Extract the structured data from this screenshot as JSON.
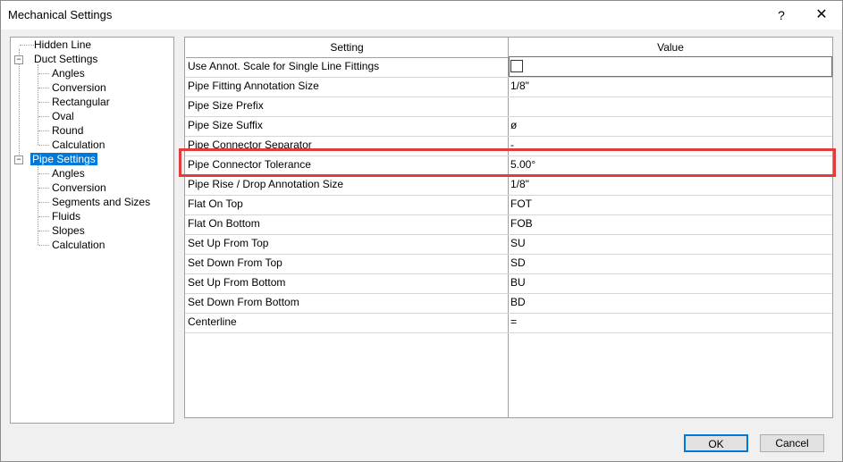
{
  "window": {
    "title": "Mechanical Settings",
    "help": "?",
    "close": "✕"
  },
  "tree": {
    "hidden_line": "Hidden Line",
    "duct_settings": "Duct Settings",
    "duct_children": [
      "Angles",
      "Conversion",
      "Rectangular",
      "Oval",
      "Round",
      "Calculation"
    ],
    "pipe_settings": "Pipe Settings",
    "pipe_children": [
      "Angles",
      "Conversion",
      "Segments and Sizes",
      "Fluids",
      "Slopes",
      "Calculation"
    ],
    "selected": "Pipe Settings",
    "collapse_glyph": "−"
  },
  "grid": {
    "headers": {
      "setting": "Setting",
      "value": "Value"
    },
    "rows": [
      {
        "setting": "Use Annot. Scale for Single Line Fittings",
        "value": ""
      },
      {
        "setting": "Pipe Fitting Annotation Size",
        "value": "1/8\""
      },
      {
        "setting": "Pipe Size Prefix",
        "value": ""
      },
      {
        "setting": "Pipe Size Suffix",
        "value": "ø"
      },
      {
        "setting": "Pipe Connector Separator",
        "value": "-"
      },
      {
        "setting": "Pipe Connector Tolerance",
        "value": "5.00°"
      },
      {
        "setting": "Pipe Rise / Drop Annotation Size",
        "value": "1/8\""
      },
      {
        "setting": "Flat On Top",
        "value": "FOT"
      },
      {
        "setting": "Flat On Bottom",
        "value": "FOB"
      },
      {
        "setting": "Set Up From Top",
        "value": "SU"
      },
      {
        "setting": "Set Down From Top",
        "value": "SD"
      },
      {
        "setting": "Set Up From Bottom",
        "value": "BU"
      },
      {
        "setting": "Set Down From Bottom",
        "value": "BD"
      },
      {
        "setting": "Centerline",
        "value": "="
      }
    ],
    "checkbox_checked": false
  },
  "buttons": {
    "ok": "OK",
    "cancel": "Cancel"
  },
  "colors": {
    "selection": "#0078d7",
    "highlight": "#e23b3b"
  }
}
